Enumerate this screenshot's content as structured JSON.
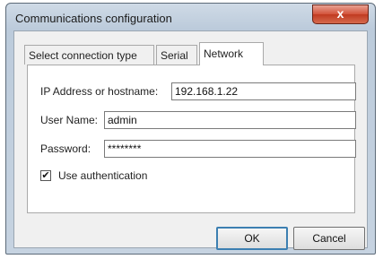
{
  "window": {
    "title": "Communications configuration",
    "close_glyph": "x"
  },
  "tabs": [
    {
      "label": "Select connection type"
    },
    {
      "label": "Serial"
    },
    {
      "label": "Network"
    }
  ],
  "form": {
    "ip_label": "IP Address or hostname:",
    "ip_value": "192.168.1.22",
    "user_label": "User Name:",
    "user_value": "admin",
    "password_label": "Password:",
    "password_value": "********",
    "auth_label": "Use authentication",
    "auth_checked": true,
    "check_glyph": "✔"
  },
  "buttons": {
    "ok": "OK",
    "cancel": "Cancel"
  },
  "colors": {
    "close_button": "#d3523a",
    "title_bar": "#bccbdb",
    "panel": "#ffffff"
  }
}
